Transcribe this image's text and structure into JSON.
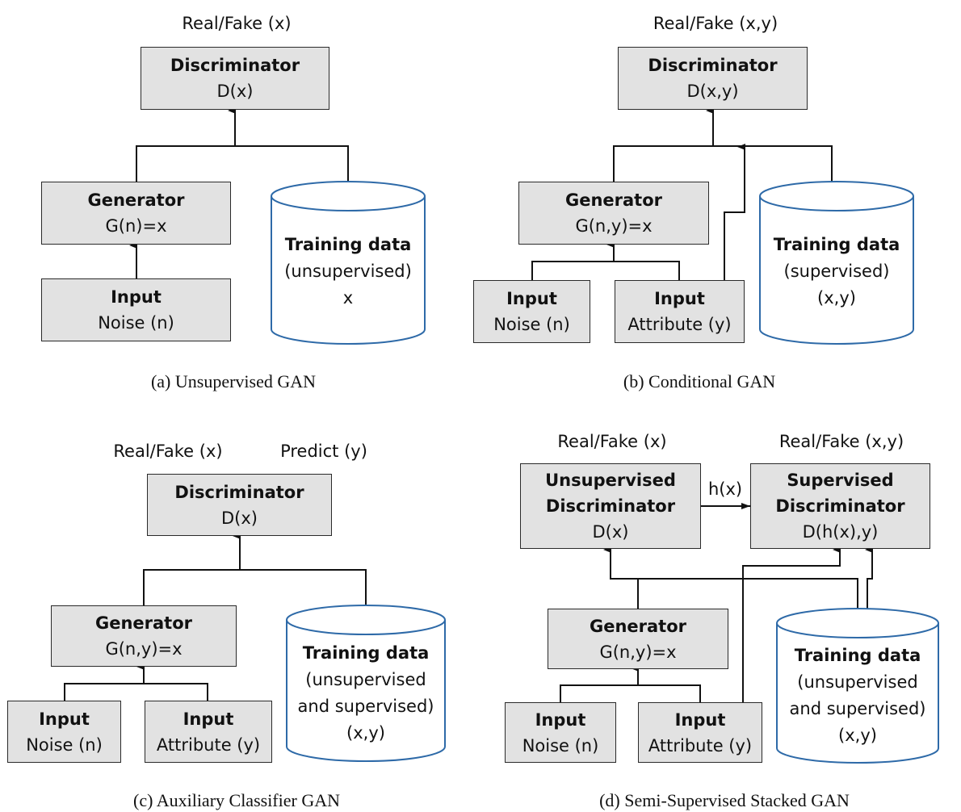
{
  "colors": {
    "box_fill": "#e2e2e2",
    "box_border": "#2a2a2a",
    "cylinder_stroke": "#2e6aa8",
    "line": "#111111"
  },
  "panels": {
    "a": {
      "caption": "(a) Unsupervised GAN",
      "output_label": "Real/Fake (x)",
      "discriminator": {
        "title": "Discriminator",
        "formula": "D(x)"
      },
      "generator": {
        "title": "Generator",
        "formula": "G(n)=x"
      },
      "input_noise": {
        "title": "Input",
        "sub": "Noise (n)"
      },
      "training": {
        "title": "Training data",
        "lines": [
          "(unsupervised)",
          "x"
        ]
      }
    },
    "b": {
      "caption": "(b) Conditional GAN",
      "output_label": "Real/Fake (x,y)",
      "discriminator": {
        "title": "Discriminator",
        "formula": "D(x,y)"
      },
      "generator": {
        "title": "Generator",
        "formula": "G(n,y)=x"
      },
      "input_noise": {
        "title": "Input",
        "sub": "Noise (n)"
      },
      "input_attr": {
        "title": "Input",
        "sub": "Attribute (y)"
      },
      "training": {
        "title": "Training data",
        "lines": [
          "(supervised)",
          "(x,y)"
        ]
      }
    },
    "c": {
      "caption": "(c) Auxiliary Classifier GAN",
      "output_label": "Real/Fake (x)",
      "predict_label": "Predict (y)",
      "discriminator": {
        "title": "Discriminator",
        "formula": "D(x)"
      },
      "generator": {
        "title": "Generator",
        "formula": "G(n,y)=x"
      },
      "input_noise": {
        "title": "Input",
        "sub": "Noise (n)"
      },
      "input_attr": {
        "title": "Input",
        "sub": "Attribute (y)"
      },
      "training": {
        "title": "Training data",
        "lines": [
          "(unsupervised",
          "and supervised)",
          "(x,y)"
        ]
      }
    },
    "d": {
      "caption": "(d) Semi-Supervised Stacked GAN",
      "output_label_left": "Real/Fake (x)",
      "output_label_right": "Real/Fake (x,y)",
      "hx_label": "h(x)",
      "unsup_disc": {
        "title1": "Unsupervised",
        "title2": "Discriminator",
        "formula": "D(x)"
      },
      "sup_disc": {
        "title1": "Supervised",
        "title2": "Discriminator",
        "formula": "D(h(x),y)"
      },
      "generator": {
        "title": "Generator",
        "formula": "G(n,y)=x"
      },
      "input_noise": {
        "title": "Input",
        "sub": "Noise (n)"
      },
      "input_attr": {
        "title": "Input",
        "sub": "Attribute (y)"
      },
      "training": {
        "title": "Training data",
        "lines": [
          "(unsupervised",
          "and supervised)",
          "(x,y)"
        ]
      }
    }
  }
}
